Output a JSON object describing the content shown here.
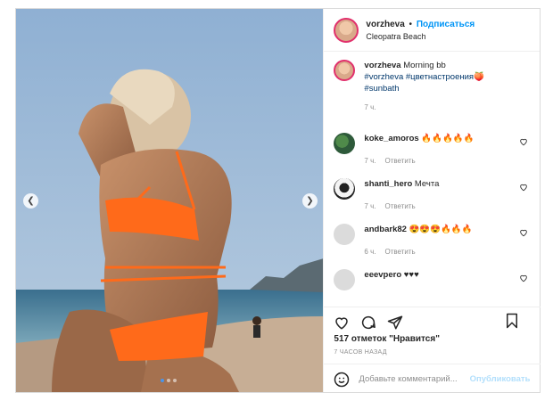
{
  "post": {
    "username": "vorzheva",
    "separator": "•",
    "follow_label": "Подписаться",
    "location": "Cleopatra Beach",
    "carousel": {
      "slides": 3,
      "active_index": 0
    }
  },
  "caption": {
    "username": "vorzheva",
    "text": "Morning bb",
    "tags": [
      "#vorzheva",
      "#цветнастроения🍑",
      "#sunbath"
    ],
    "time": "7 ч."
  },
  "comments": [
    {
      "username": "koke_amoros",
      "text": "🔥🔥🔥🔥🔥",
      "time": "7 ч.",
      "reply": "Ответить"
    },
    {
      "username": "shanti_hero",
      "text": "Мечта",
      "time": "7 ч.",
      "reply": "Ответить"
    },
    {
      "username": "andbark82",
      "text": "😍😍😍🔥🔥🔥",
      "time": "6 ч.",
      "reply": "Ответить"
    },
    {
      "username": "eeevpero",
      "text": "♥♥♥",
      "time": "",
      "reply": ""
    }
  ],
  "actions": {
    "likes": "517 отметок \"Нравится\"",
    "timestamp": "7 ЧАСОВ НАЗАД"
  },
  "add_comment": {
    "placeholder": "Добавьте комментарий...",
    "publish_label": "Опубликовать"
  },
  "colors": {
    "accent": "#0095f6",
    "publish_disabled": "#b2dffc",
    "muted": "#8e8e8e",
    "bikini": "#ff6a1a"
  },
  "icons": {
    "prev": "chevron-left-icon",
    "next": "chevron-right-icon",
    "like": "heart-icon",
    "comment": "comment-icon",
    "share": "paper-plane-icon",
    "save": "bookmark-icon",
    "emoji": "smiley-icon"
  }
}
